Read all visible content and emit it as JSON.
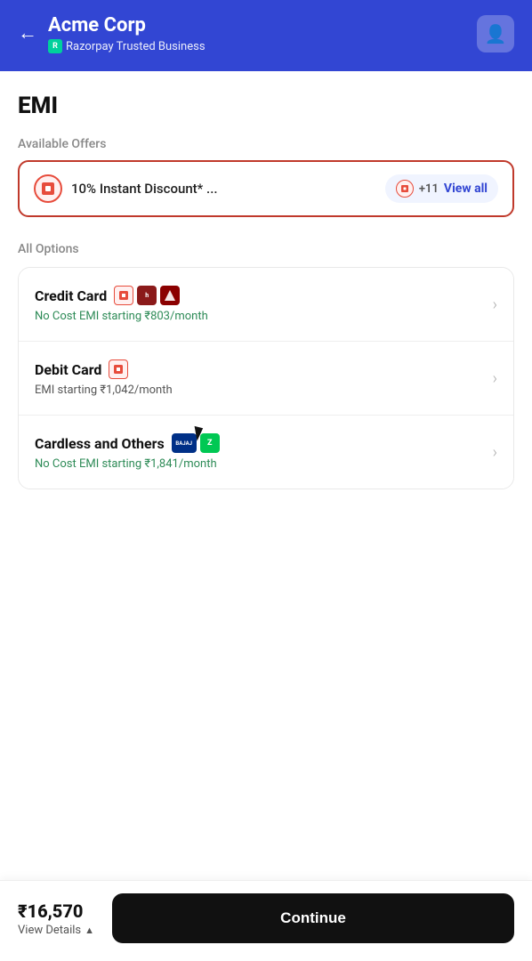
{
  "header": {
    "back_label": "←",
    "title": "Acme Corp",
    "subtitle": "Razorpay Trusted Business",
    "profile_icon": "👤"
  },
  "page": {
    "title": "EMI",
    "available_offers_label": "Available Offers",
    "offer_text": "10% Instant Discount* ...",
    "offer_count": "+11",
    "view_all_label": "View all",
    "all_options_label": "All Options",
    "options": [
      {
        "title": "Credit Card",
        "subtitle": "No Cost EMI starting ₹803/month",
        "subtitle_green": true
      },
      {
        "title": "Debit Card",
        "subtitle": "EMI starting ₹1,042/month",
        "subtitle_green": false
      },
      {
        "title": "Cardless and Others",
        "subtitle": "No Cost EMI starting ₹1,841/month",
        "subtitle_green": true
      }
    ]
  },
  "footer": {
    "amount": "₹16,570",
    "details_label": "View Details",
    "continue_label": "Continue"
  }
}
